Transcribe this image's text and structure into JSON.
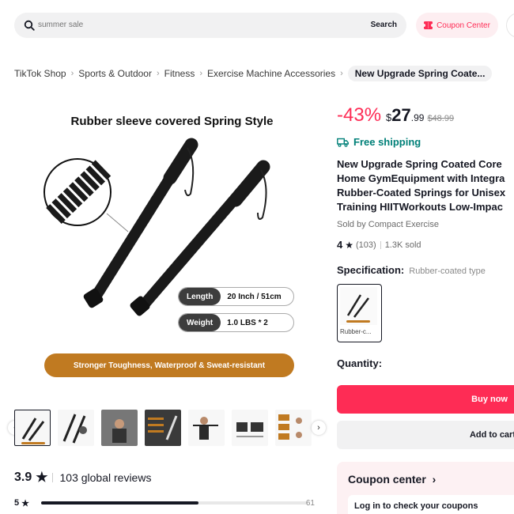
{
  "search": {
    "placeholder": "summer sale",
    "button_label": "Search"
  },
  "header": {
    "coupon_center_label": "Coupon Center"
  },
  "breadcrumb": {
    "items": [
      "TikTok Shop",
      "Sports & Outdoor",
      "Fitness",
      "Exercise Machine Accessories"
    ],
    "current": "New Upgrade Spring Coate..."
  },
  "image": {
    "title": "Rubber sleeve covered Spring Style",
    "specs": [
      {
        "key": "Length",
        "value": "20 Inch / 51cm"
      },
      {
        "key": "Weight",
        "value": "1.0 LBS * 2"
      }
    ],
    "banner": "Stronger Toughness, Waterproof & Sweat-resistant"
  },
  "product": {
    "discount": "-43%",
    "currency": "$",
    "price_int": "27",
    "price_dec": ".99",
    "original_price": "$48.99",
    "shipping": "Free shipping",
    "title_lines": [
      "New Upgrade Spring Coated Core",
      "Home GymEquipment with Integra",
      "Rubber-Coated Springs for Unisex",
      "Training HIITWorkouts Low-Impac"
    ],
    "seller": "Sold by Compact Exercise",
    "rating": "4",
    "review_count": "(103)",
    "sold": "1.3K sold",
    "spec_label": "Specification:",
    "spec_value": "Rubber-coated type",
    "variant_label": "Rubber-c...",
    "quantity_label": "Quantity:",
    "buy_now": "Buy now",
    "add_to_cart": "Add to cart"
  },
  "coupon": {
    "title": "Coupon center",
    "login": "Log in to check your coupons"
  },
  "reviews": {
    "rating": "3.9",
    "global": "103 global reviews",
    "bars": [
      {
        "star": "5",
        "count": "61",
        "fraction": 0.59
      }
    ]
  },
  "colors": {
    "accent": "#fe2c55",
    "shipping": "#008078",
    "banner": "#c07a21"
  }
}
